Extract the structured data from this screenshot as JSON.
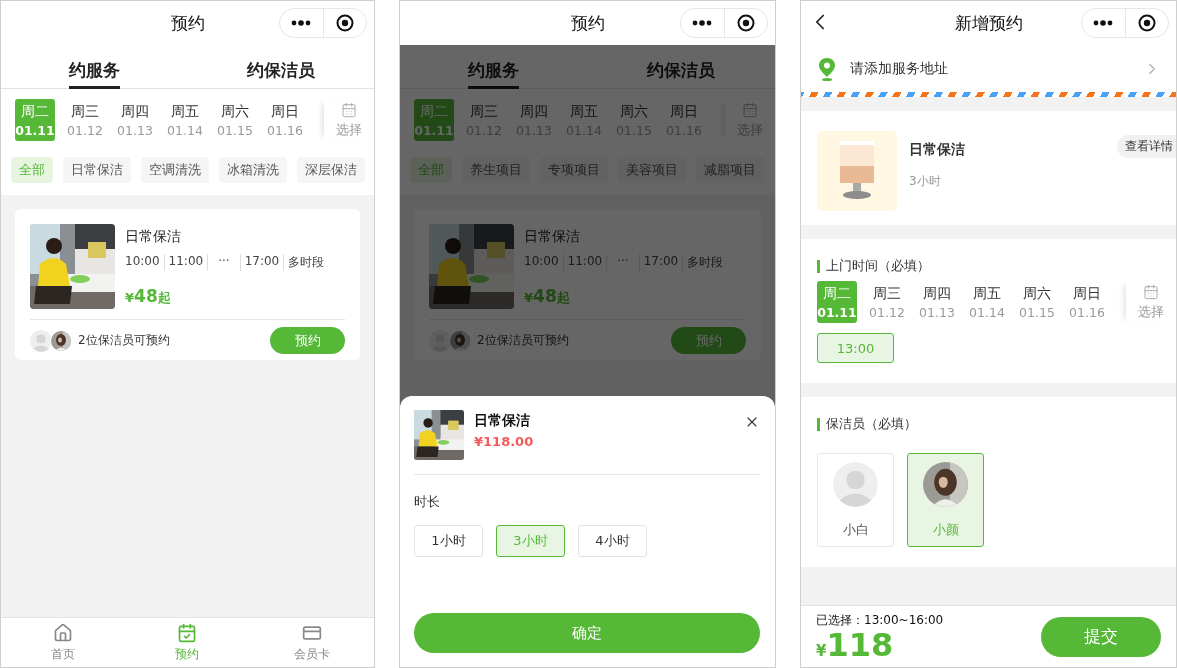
{
  "booking_list": {
    "title": "预约",
    "dimmed": false,
    "tabs": [
      {
        "label": "约服务",
        "selected": true
      },
      {
        "label": "约保洁员",
        "selected": false
      }
    ],
    "dates": [
      {
        "weekday": "周二",
        "date": "01.11",
        "selected": true
      },
      {
        "weekday": "周三",
        "date": "01.12",
        "selected": false
      },
      {
        "weekday": "周四",
        "date": "01.13",
        "selected": false
      },
      {
        "weekday": "周五",
        "date": "01.14",
        "selected": false
      },
      {
        "weekday": "周六",
        "date": "01.15",
        "selected": false
      },
      {
        "weekday": "周日",
        "date": "01.16",
        "selected": false
      }
    ],
    "date_picker": "选择",
    "categories": [
      {
        "label": "全部",
        "selected": true
      },
      {
        "label": "日常保洁",
        "selected": false
      },
      {
        "label": "空调清洗",
        "selected": false
      },
      {
        "label": "冰箱清洗",
        "selected": false
      },
      {
        "label": "深层保洁",
        "selected": false
      }
    ],
    "cards": [
      {
        "title": "日常保洁",
        "times": [
          "10:00",
          "11:00",
          "···",
          "17:00",
          "多时段"
        ],
        "currency": "¥",
        "price": "48",
        "price_suffix": "起",
        "cleaners_text": "2位保洁员可预约",
        "button": "预约"
      }
    ],
    "bottom_nav": [
      {
        "label": "首页",
        "selected": false
      },
      {
        "label": "预约",
        "selected": true
      },
      {
        "label": "会员卡",
        "selected": false
      }
    ]
  },
  "booking_list_with_sheet": {
    "title": "预约",
    "dimmed": true,
    "tabs": [
      {
        "label": "约服务",
        "selected": true
      },
      {
        "label": "约保洁员",
        "selected": false
      }
    ],
    "dates": [
      {
        "weekday": "周二",
        "date": "01.11",
        "selected": true
      },
      {
        "weekday": "周三",
        "date": "01.12",
        "selected": false
      },
      {
        "weekday": "周四",
        "date": "01.13",
        "selected": false
      },
      {
        "weekday": "周五",
        "date": "01.14",
        "selected": false
      },
      {
        "weekday": "周六",
        "date": "01.15",
        "selected": false
      },
      {
        "weekday": "周日",
        "date": "01.16",
        "selected": false
      }
    ],
    "date_picker": "选择",
    "categories": [
      {
        "label": "全部",
        "selected": true
      },
      {
        "label": "养生项目",
        "selected": false
      },
      {
        "label": "专项项目",
        "selected": false
      },
      {
        "label": "美容项目",
        "selected": false
      },
      {
        "label": "减脂项目",
        "selected": false
      }
    ],
    "cards": [
      {
        "title": "日常保洁",
        "times": [
          "10:00",
          "11:00",
          "···",
          "17:00",
          "多时段"
        ],
        "currency": "¥",
        "price": "48",
        "price_suffix": "起",
        "cleaners_text": "2位保洁员可预约",
        "button": "预约"
      }
    ],
    "sheet": {
      "title": "日常保洁",
      "price": "¥118.00",
      "section_label": "时长",
      "durations": [
        {
          "label": "1小时",
          "selected": false
        },
        {
          "label": "3小时",
          "selected": true
        },
        {
          "label": "4小时",
          "selected": false
        }
      ],
      "confirm": "确定"
    }
  },
  "new_booking": {
    "title": "新增预约",
    "address_placeholder": "请添加服务地址",
    "product": {
      "title": "日常保洁",
      "duration": "3小时",
      "details_button": "查看详情"
    },
    "time_section": {
      "heading": "上门时间（必填）",
      "dates": [
        {
          "weekday": "周二",
          "date": "01.11",
          "selected": true
        },
        {
          "weekday": "周三",
          "date": "01.12",
          "selected": false
        },
        {
          "weekday": "周四",
          "date": "01.13",
          "selected": false
        },
        {
          "weekday": "周五",
          "date": "01.14",
          "selected": false
        },
        {
          "weekday": "周六",
          "date": "01.15",
          "selected": false
        },
        {
          "weekday": "周日",
          "date": "01.16",
          "selected": false
        }
      ],
      "date_picker": "选择",
      "slots": [
        {
          "label": "13:00",
          "selected": true
        }
      ]
    },
    "cleaner_section": {
      "heading": "保洁员（必填）",
      "cleaners": [
        {
          "name": "小白",
          "has_photo": false,
          "selected": false
        },
        {
          "name": "小颜",
          "has_photo": true,
          "selected": true
        }
      ]
    },
    "footer": {
      "selection": "已选择：13:00~16:00",
      "currency": "¥",
      "total": "118",
      "submit": "提交"
    }
  }
}
